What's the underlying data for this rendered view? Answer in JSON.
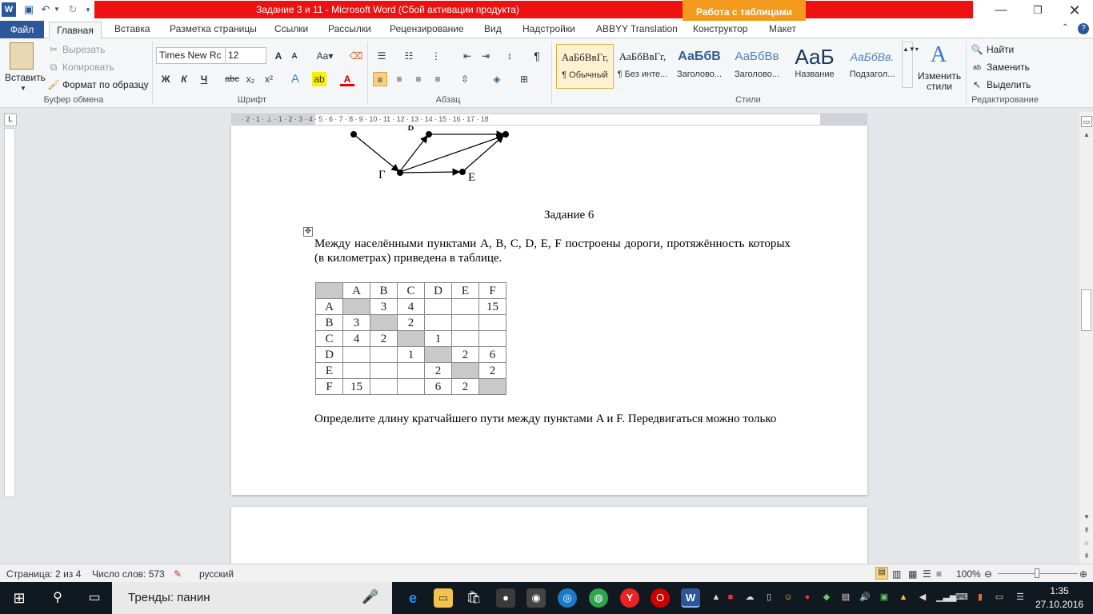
{
  "window": {
    "title": "Задание 3 и 11  -  Microsoft Word (Сбой активации продукта)",
    "context_tab_header": "Работа с таблицами",
    "controls": [
      "minimize",
      "restore",
      "close"
    ]
  },
  "tabs": [
    "Файл",
    "Главная",
    "Вставка",
    "Разметка страницы",
    "Ссылки",
    "Рассылки",
    "Рецензирование",
    "Вид",
    "Надстройки",
    "ABBYY Translation",
    "Конструктор",
    "Макет"
  ],
  "ribbon": {
    "clipboard": {
      "paste": "Вставить",
      "cut": "Вырезать",
      "copy": "Копировать",
      "format_painter": "Формат по образцу",
      "label": "Буфер обмена"
    },
    "font": {
      "name": "Times New Rc",
      "size": "12",
      "bold": "Ж",
      "italic": "К",
      "underline": "Ч",
      "strike": "abc",
      "label": "Шрифт"
    },
    "paragraph": {
      "label": "Абзац"
    },
    "styles": {
      "items": [
        {
          "sample": "АаБбВвГг,",
          "name": "¶ Обычный"
        },
        {
          "sample": "АаБбВвГг,",
          "name": "¶ Без инте..."
        },
        {
          "sample": "АаБбВ",
          "name": "Заголово..."
        },
        {
          "sample": "АаБбВв",
          "name": "Заголово..."
        },
        {
          "sample": "АаБ",
          "name": "Название"
        },
        {
          "sample": "АаБбВв.",
          "name": "Подзагол..."
        }
      ],
      "change": "Изменить стили",
      "label": "Стили"
    },
    "editing": {
      "find": "Найти",
      "replace": "Заменить",
      "select": "Выделить",
      "label": "Редактирование"
    }
  },
  "ruler": {
    "text": "· 2 · 1 · ⊥ · 1 · 2 · 3 · 4 · 5 · 6 · 7 · 8 · 9 · 10 · 11 · 12 · 13 · 14 · 15 · 16 · 17 · 18"
  },
  "document": {
    "graph_labels": [
      "Г",
      "Е",
      "Б"
    ],
    "task_heading": "Задание 6",
    "paragraph1_line1": "Между населёнными пунктами A, B, C, D, E, F построены дороги, протяжённость которых",
    "paragraph1_line2": "(в километрах) приведена в таблице.",
    "table": {
      "headers": [
        "",
        "A",
        "B",
        "C",
        "D",
        "E",
        "F"
      ],
      "rows": [
        [
          "A",
          "",
          "3",
          "4",
          "",
          "",
          "15"
        ],
        [
          "B",
          "3",
          "",
          "2",
          "",
          "",
          ""
        ],
        [
          "C",
          "4",
          "2",
          "",
          "1",
          "",
          ""
        ],
        [
          "D",
          "",
          "",
          "1",
          "",
          "2",
          "6"
        ],
        [
          "E",
          "",
          "",
          "",
          "2",
          "",
          "2"
        ],
        [
          "F",
          "15",
          "",
          "",
          "6",
          "2",
          ""
        ]
      ]
    },
    "paragraph2": "Определите длину кратчайшего пути между пунктами A и F. Передвигаться можно только"
  },
  "status": {
    "page": "Страница: 2 из 4",
    "words": "Число слов: 573",
    "language": "русский",
    "zoom": "100%"
  },
  "taskbar": {
    "search": "Тренды: панин",
    "time": "1:35",
    "date": "27.10.2016"
  }
}
